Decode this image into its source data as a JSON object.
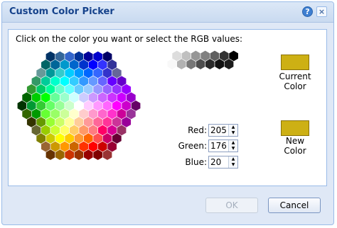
{
  "window": {
    "title": "Custom Color Picker"
  },
  "titlebar": {
    "help_icon": "help-icon",
    "help_glyph": "?",
    "close_icon": "close-icon",
    "close_glyph": "×"
  },
  "instruction": "Click on the color you want or select the RGB values:",
  "palette": {
    "rows": [
      [
        "#003366",
        "#336699",
        "#3366CC",
        "#003399",
        "#000099",
        "#0000CC",
        "#000066"
      ],
      [
        "#006666",
        "#006699",
        "#0099CC",
        "#0066CC",
        "#0033CC",
        "#0000FF",
        "#3333FF",
        "#333399"
      ],
      [
        "#669999",
        "#009999",
        "#33CCCC",
        "#00CCFF",
        "#0099FF",
        "#0066FF",
        "#3366FF",
        "#3333CC",
        "#666699"
      ],
      [
        "#339966",
        "#00CC99",
        "#00FFCC",
        "#00FFFF",
        "#33CCFF",
        "#3399FF",
        "#6699FF",
        "#6666FF",
        "#6600FF",
        "#6600CC"
      ],
      [
        "#339933",
        "#00CC66",
        "#00FF99",
        "#66FFCC",
        "#66FFFF",
        "#66CCFF",
        "#99CCFF",
        "#9999FF",
        "#9966FF",
        "#9933FF",
        "#9900FF"
      ],
      [
        "#006600",
        "#00CC00",
        "#00FF00",
        "#66FF99",
        "#99FFCC",
        "#CCFFFF",
        "#CCCCFF",
        "#CC99FF",
        "#CC66FF",
        "#CC33FF",
        "#CC00FF",
        "#9900CC"
      ],
      [
        "#003300",
        "#009933",
        "#33CC33",
        "#66FF66",
        "#99FF99",
        "#CCFFCC",
        "#FFFFFF",
        "#FFCCFF",
        "#FF99FF",
        "#FF66FF",
        "#FF00FF",
        "#CC00CC",
        "#660066"
      ],
      [
        "#336600",
        "#009900",
        "#66FF33",
        "#99FF66",
        "#CCFF99",
        "#FFFFCC",
        "#FFCCCC",
        "#FF99CC",
        "#FF66CC",
        "#FF33CC",
        "#CC0099",
        "#993399"
      ],
      [
        "#333300",
        "#669900",
        "#99FF33",
        "#CCFF66",
        "#FFFF99",
        "#FFCC99",
        "#FF9999",
        "#FF6699",
        "#FF3399",
        "#CC3399",
        "#990099"
      ],
      [
        "#666633",
        "#99CC00",
        "#CCFF33",
        "#FFFF66",
        "#FFCC66",
        "#FF9966",
        "#FF7C80",
        "#FF0066",
        "#D60093",
        "#993366"
      ],
      [
        "#808000",
        "#CCCC00",
        "#FFFF00",
        "#FFCC00",
        "#FF9933",
        "#FF6600",
        "#FF5050",
        "#CC0066",
        "#660033"
      ],
      [
        "#996633",
        "#CC9900",
        "#FF9900",
        "#CC6600",
        "#FF3300",
        "#FF0000",
        "#CC0000",
        "#990033"
      ],
      [
        "#663300",
        "#996600",
        "#CC3300",
        "#993300",
        "#990000",
        "#800000",
        "#993333"
      ]
    ],
    "grays": [
      [
        "#FFFFFF",
        "#DDDDDD",
        "#C0C0C0",
        "#969696",
        "#808080",
        "#5F5F5F",
        "#333333",
        "#000000"
      ],
      [
        "#F8F8F8",
        "#B2B2B2",
        "#777777",
        "#4D4D4D",
        "#292929",
        "#111111",
        "#1C1C1C"
      ]
    ]
  },
  "current_color": {
    "label": "Current Color",
    "line1": "Current",
    "line2": "Color",
    "value": "#CDB014"
  },
  "new_color": {
    "label": "New Color",
    "line1": "New",
    "line2": "Color",
    "value": "#CDB014"
  },
  "rgb": {
    "red": {
      "label": "Red:",
      "value": "205"
    },
    "green": {
      "label": "Green:",
      "value": "176"
    },
    "blue": {
      "label": "Blue:",
      "value": "20"
    },
    "up_glyph": "▲",
    "down_glyph": "▼"
  },
  "buttons": {
    "ok": "OK",
    "cancel": "Cancel"
  }
}
